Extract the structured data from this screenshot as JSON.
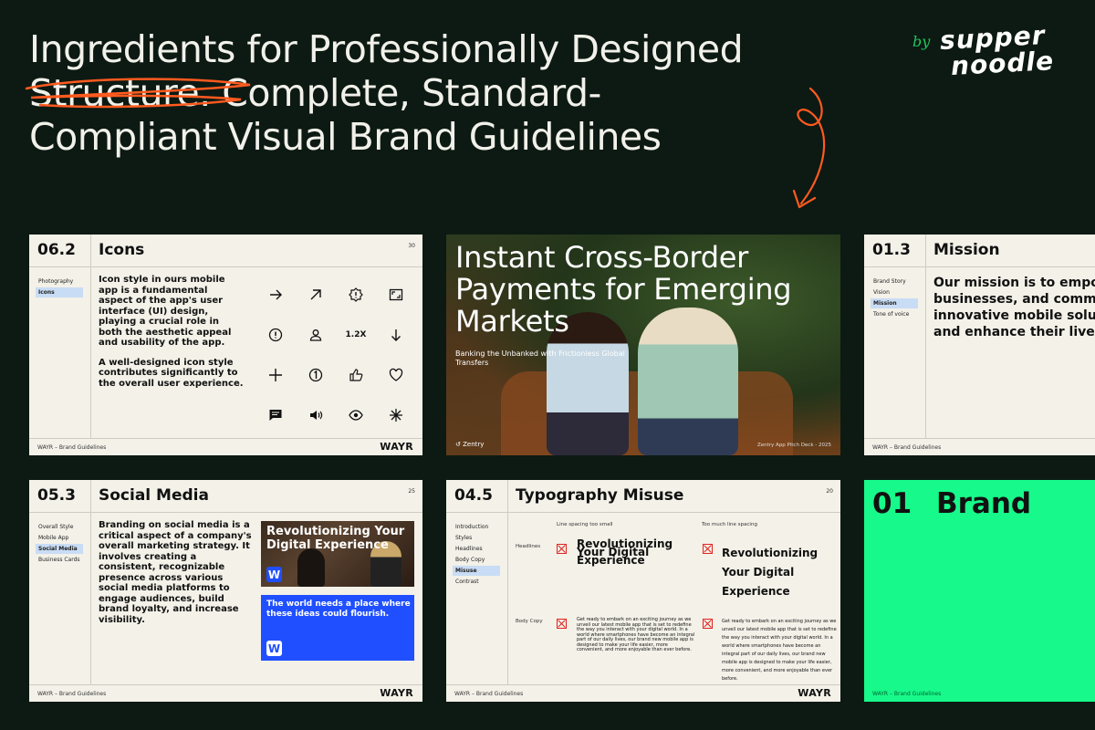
{
  "headline": {
    "line1": "Ingredients for Professionally Designed",
    "line2": "Structure. Complete, Standard-",
    "line3": "Compliant Visual Brand Guidelines"
  },
  "logo": {
    "by": "by",
    "word1": "supper",
    "word2": "noodle"
  },
  "colors": {
    "background": "#0c1a13",
    "slide": "#f3f1e8",
    "accent_green": "#17f98a",
    "accent_blue": "#1f4fff",
    "scribble": "#ff5a1f",
    "error_red": "#e0231f"
  },
  "footer_text": "WAYR – Brand Guidelines",
  "brandmark": "WAYR",
  "slide_icons": {
    "number": "06.2",
    "title": "Icons",
    "page": "30",
    "nav": [
      "Photography",
      "Icons"
    ],
    "body_p1": "Icon style in ours mobile app is a fundamental aspect of the app's user interface (UI) design, playing a crucial role in both the aesthetic appeal and usability of the app.",
    "body_p2": "A well-designed icon style contributes significantly to the overall user experience.",
    "icons": [
      "arrow-right-icon",
      "arrow-up-right-icon",
      "badge-alert-icon",
      "frame-icon",
      "alert-circle-icon",
      "user-icon",
      "zoom-1-2x-icon",
      "arrow-down-icon",
      "plus-icon",
      "number-one-circle-icon",
      "thumbs-up-icon",
      "heart-icon",
      "message-icon",
      "volume-icon",
      "eye-icon",
      "asterisk-icon"
    ],
    "zoom_label": "1.2X"
  },
  "slide_pitch": {
    "title": "Instant Cross-Border Payments for Emerging Markets",
    "subtitle": "Banking the Unbanked with Frictionless Global Transfers",
    "brand": "Zentry",
    "footer": "Zentry App Pitch Deck - 2025"
  },
  "slide_mission": {
    "number": "01.3",
    "title": "Mission",
    "nav": [
      "Brand Story",
      "Vision",
      "Mission",
      "Tone of voice"
    ],
    "line1": "Our mission is to empow",
    "line2": "businesses, and commu",
    "line3": "innovative mobile soluti",
    "line4": "and enhance their lives."
  },
  "slide_social": {
    "number": "05.3",
    "title": "Social Media",
    "page": "25",
    "nav": [
      "Overall Style",
      "Mobile App",
      "Social Media",
      "Business Cards"
    ],
    "body": "Branding on social media is a critical aspect of a company's overall marketing strategy. It involves creating a consistent, recognizable presence across various social media platforms to engage audiences, build brand loyalty, and increase visibility.",
    "card1_title": "Revolutionizing Your Digital Experience",
    "card2_text": "The world needs a place where these ideas could flourish.",
    "badge": "W"
  },
  "slide_typo": {
    "number": "04.5",
    "title": "Typography Misuse",
    "page": "20",
    "nav": [
      "Introduction",
      "Styles",
      "Headlines",
      "Body Copy",
      "Misuse",
      "Contrast"
    ],
    "col1_label": "Line spacing too small",
    "col2_label": "Too much line spacing",
    "row1_label": "Headlines",
    "row2_label": "Body Copy",
    "headline_sample": "Revolutionizing Your Digital Experience",
    "body_sample": "Get ready to embark on an exciting journey as we unveil our latest mobile app that is set to redefine the way you interact with your digital world. In a world where smartphones have become an integral part of our daily lives, our brand new mobile app is designed to make your life easier, more convenient, and more enjoyable than ever before."
  },
  "slide_brand": {
    "number": "01",
    "title": "Brand"
  }
}
